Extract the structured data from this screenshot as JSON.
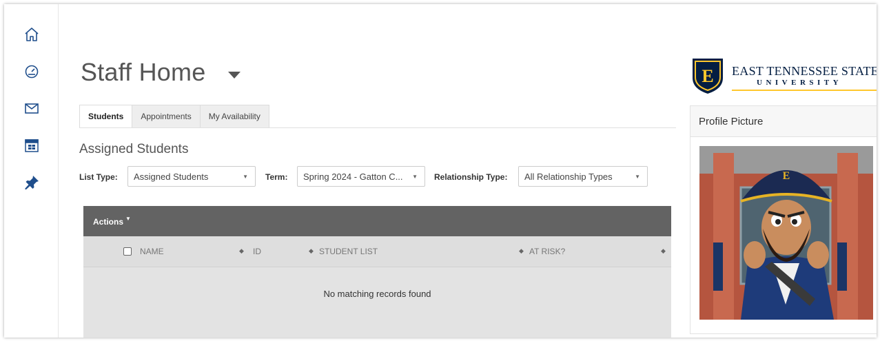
{
  "sidebar": {
    "icons": [
      "home-icon",
      "dashboard-gauge-icon",
      "mail-icon",
      "calendar-icon",
      "pin-icon"
    ]
  },
  "header": {
    "title": "Staff Home"
  },
  "tabs": [
    {
      "label": "Students",
      "active": true
    },
    {
      "label": "Appointments",
      "active": false
    },
    {
      "label": "My Availability",
      "active": false
    }
  ],
  "section": {
    "title": "Assigned Students"
  },
  "filters": {
    "list_type": {
      "label": "List Type:",
      "value": "Assigned Students"
    },
    "term": {
      "label": "Term:",
      "value": "Spring 2024 - Gatton C..."
    },
    "relationship_type": {
      "label": "Relationship Type:",
      "value": "All Relationship Types"
    }
  },
  "table": {
    "actions_label": "Actions",
    "columns": [
      "NAME",
      "ID",
      "STUDENT LIST",
      "AT RISK?"
    ],
    "empty_message": "No matching records found"
  },
  "logo": {
    "line1": "EAST TENNESSEE STATE",
    "line2": "UNIVERSITY",
    "emblem_letter": "E",
    "navy": "#041e42",
    "gold": "#ffc72c"
  },
  "profile": {
    "header": "Profile Picture"
  }
}
